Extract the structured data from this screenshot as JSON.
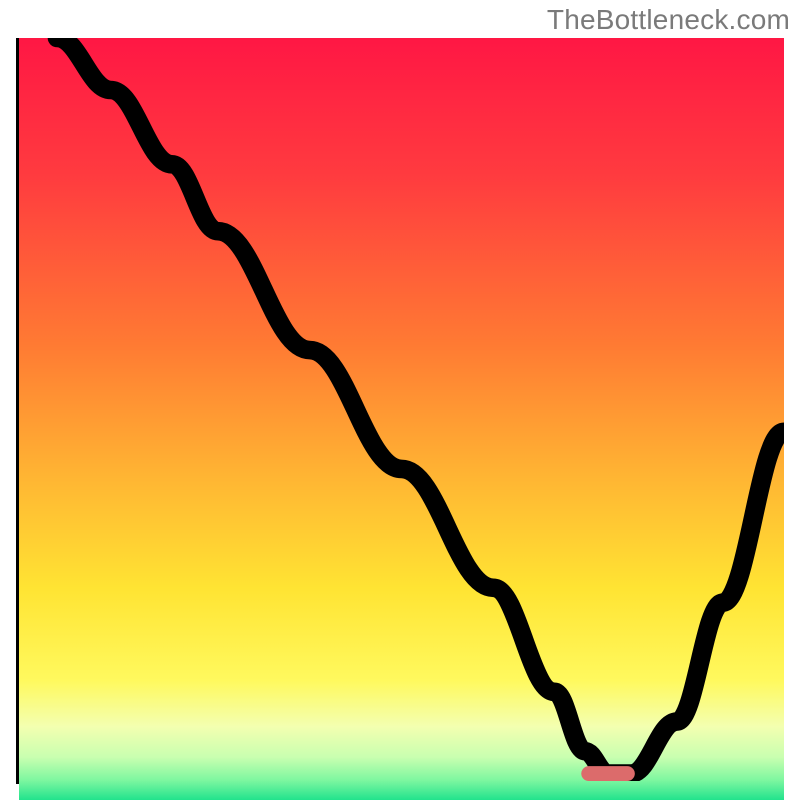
{
  "watermark": "TheBottleneck.com",
  "chart_data": {
    "type": "line",
    "title": "",
    "xlabel": "",
    "ylabel": "",
    "xlim": [
      0,
      100
    ],
    "ylim": [
      0,
      100
    ],
    "grid": false,
    "legend": false,
    "gradient_stops": [
      {
        "pos": 0.0,
        "color": "#ff1744"
      },
      {
        "pos": 0.18,
        "color": "#ff3b3f"
      },
      {
        "pos": 0.4,
        "color": "#ff7a33"
      },
      {
        "pos": 0.58,
        "color": "#ffb733"
      },
      {
        "pos": 0.72,
        "color": "#ffe433"
      },
      {
        "pos": 0.84,
        "color": "#fff95e"
      },
      {
        "pos": 0.9,
        "color": "#f3ffb0"
      },
      {
        "pos": 0.94,
        "color": "#c9ffb0"
      },
      {
        "pos": 0.97,
        "color": "#7ef7a0"
      },
      {
        "pos": 1.0,
        "color": "#14e08a"
      }
    ],
    "series": [
      {
        "name": "bottleneck-curve",
        "x": [
          5,
          12,
          20,
          26,
          38,
          50,
          62,
          70,
          74,
          77,
          80,
          86,
          92,
          100
        ],
        "y": [
          100,
          93,
          83,
          74,
          58,
          42,
          26,
          12,
          4,
          1,
          1,
          8,
          24,
          47
        ]
      }
    ],
    "marker": {
      "x": 77,
      "y": 1,
      "width": 7,
      "height": 2
    }
  }
}
